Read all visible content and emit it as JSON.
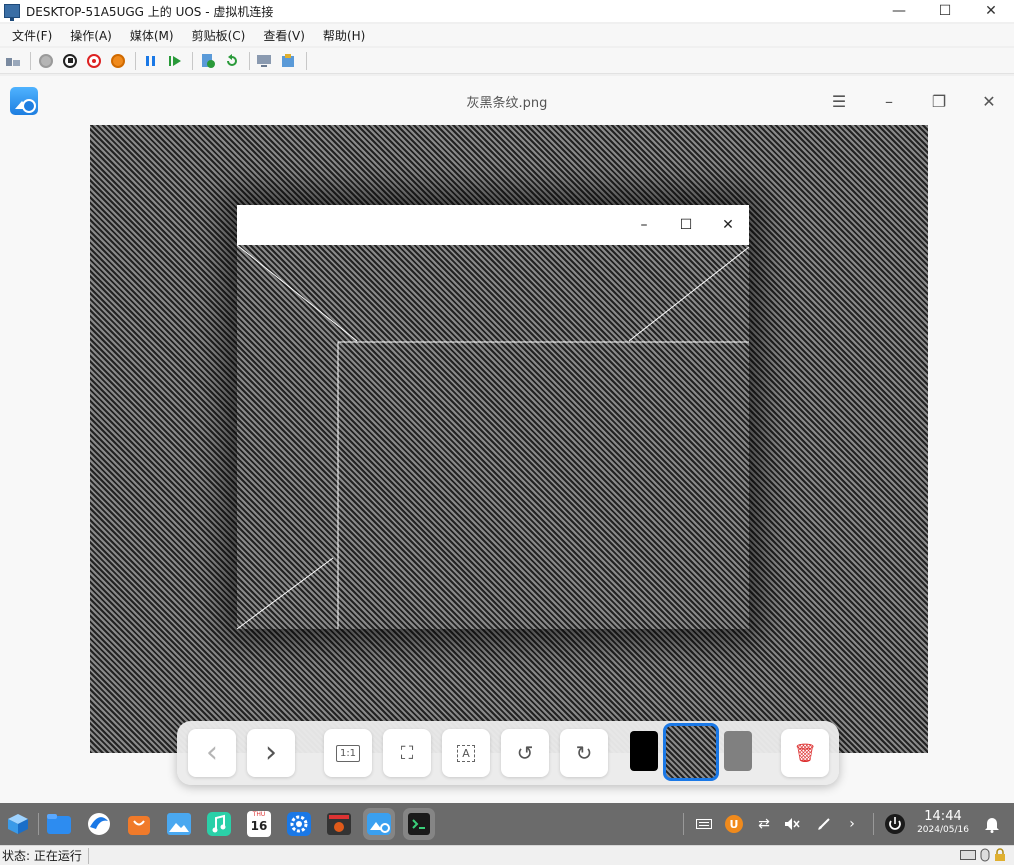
{
  "host": {
    "title": "DESKTOP-51A5UGG 上的 UOS - 虚拟机连接",
    "menu": [
      "文件(F)",
      "操作(A)",
      "媒体(M)",
      "剪贴板(C)",
      "查看(V)",
      "帮助(H)"
    ],
    "toolbar_icons": [
      "ctrl-alt-del-icon",
      "power-on-icon",
      "stop-icon",
      "shutdown-icon",
      "power-icon",
      "pause-icon",
      "resume-icon",
      "checkpoint-icon",
      "revert-icon",
      "enhanced-session-icon",
      "share-icon"
    ],
    "status_label": "状态: 正在运行"
  },
  "viewer": {
    "filename": "灰黑条纹.png",
    "menu_icon": "☰",
    "minimize_icon": "–",
    "maximize_icon": "❐",
    "close_icon": "✕"
  },
  "inner_window": {
    "minimize_icon": "–",
    "maximize_icon": "☐",
    "close_icon": "✕"
  },
  "bottom_bar": {
    "prev": "‹",
    "next": "›",
    "original_size": "1:1",
    "fit_window": "⛶",
    "ocr": "A",
    "rotate_left": "↺",
    "rotate_right": "↻",
    "delete": "🗑"
  },
  "taskbar": {
    "time": "14:44",
    "date": "2024/05/16",
    "calendar_day": "16",
    "calendar_month": "THU"
  },
  "colors": {
    "accent": "#1a78e6",
    "stripe_dark": "#222222",
    "stripe_light": "#8a8a8a",
    "taskbar": "#6b6b6b"
  }
}
